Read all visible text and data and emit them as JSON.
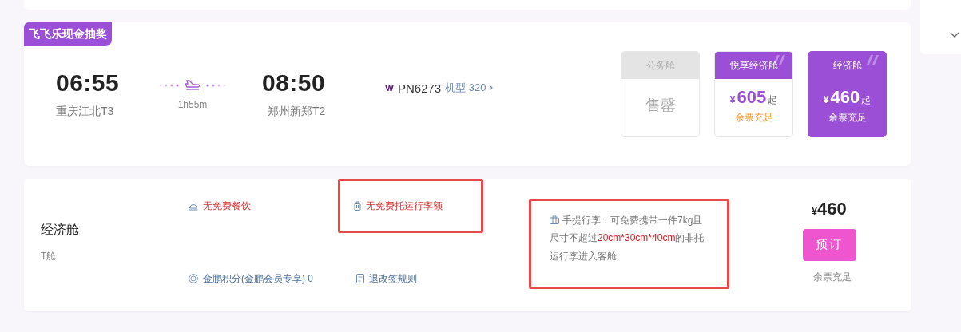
{
  "promo_badge": "飞飞乐现金抽奖",
  "flight": {
    "depart_time": "06:55",
    "depart_airport": "重庆江北T3",
    "duration": "1h55m",
    "arrive_time": "08:50",
    "arrive_airport": "郑州新郑T2",
    "flight_no": "PN6273",
    "aircraft_link": "机型 320"
  },
  "fares": [
    {
      "kind": "soldout",
      "cabin": "公务舱",
      "status": "售罄",
      "selected": false
    },
    {
      "kind": "price",
      "cabin": "悦享经济舱",
      "currency": "¥",
      "price": "605",
      "suffix": "起",
      "availability": "余票充足",
      "selected": false
    },
    {
      "kind": "price",
      "cabin": "经济舱",
      "currency": "¥",
      "price": "460",
      "suffix": "起",
      "availability": "余票充足",
      "selected": true
    }
  ],
  "cabin_detail": {
    "name": "经济舱",
    "class_code": "T舱",
    "perks": [
      {
        "kind": "meal",
        "text": "无免费餐饮",
        "warning": true,
        "highlighted": false
      },
      {
        "kind": "suitcase",
        "text": "无免费托运行李额",
        "warning": true,
        "highlighted": true
      },
      {
        "kind": "coin",
        "text": "金鹏积分(金鹏会员专享) 0",
        "warning": false,
        "highlighted": false
      },
      {
        "kind": "document",
        "text": "退改签规则",
        "warning": false,
        "highlighted": false
      }
    ],
    "carry_on": {
      "text": "手提行李：可免费携带一件7kg且尺寸不超过**20cm*30cm*40cm**的非托运行李进入客舱",
      "highlighted": true
    },
    "price": {
      "currency": "¥",
      "amount": "460"
    },
    "book_button": "预订",
    "availability": "余票充足"
  }
}
